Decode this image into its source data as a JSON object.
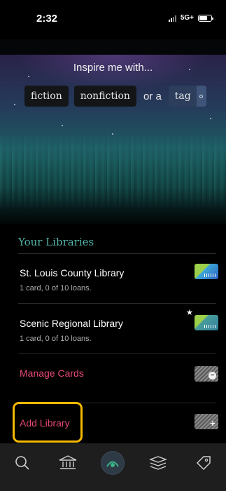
{
  "status": {
    "time": "2:32",
    "network": "5G+"
  },
  "inspire": {
    "title": "Inspire me with...",
    "options": [
      "fiction",
      "nonfiction"
    ],
    "or_text": "or a",
    "tag_label": "tag"
  },
  "libraries": {
    "section_title": "Your Libraries",
    "items": [
      {
        "name": "St. Louis County Library",
        "detail": "1 card, 0 of 10 loans."
      },
      {
        "name": "Scenic Regional Library",
        "detail": "1 card, 0 of 10 loans."
      }
    ],
    "manage_label": "Manage Cards",
    "add_label": "Add Library"
  },
  "tabs": [
    {
      "name": "search",
      "icon": "search-icon"
    },
    {
      "name": "library",
      "icon": "library-icon"
    },
    {
      "name": "home",
      "icon": "libby-home-icon",
      "active": true
    },
    {
      "name": "shelf",
      "icon": "shelf-icon"
    },
    {
      "name": "tags",
      "icon": "tag-icon"
    }
  ],
  "colors": {
    "accent_teal": "#52b3a8",
    "action_pink": "#e84a74",
    "highlight": "#f5b800"
  }
}
